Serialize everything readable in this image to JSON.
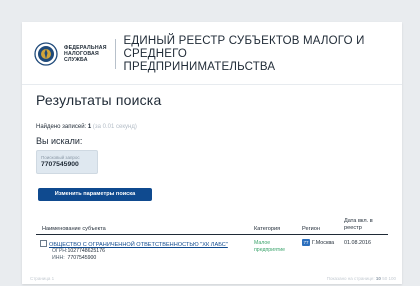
{
  "header": {
    "org_line1": "ФЕДЕРАЛЬНАЯ",
    "org_line2": "НАЛОГОВАЯ СЛУЖБА",
    "registry_title_line1": "ЕДИНЫЙ РЕЕСТР СУБЪЕКТОВ МАЛОГО И СРЕДНЕГО",
    "registry_title_line2": "ПРЕДПРИНИМАТЕЛЬСТВА"
  },
  "results": {
    "title": "Результаты поиска",
    "found_label": "Найдено записей:",
    "found_count": "1",
    "found_note": "(за 0.01 секунд)",
    "you_searched_label": "Вы искали:",
    "query_label": "Поисковый запрос",
    "query_value": "7707545900",
    "change_button": "Изменить параметры поиска"
  },
  "table": {
    "headers": {
      "subject": "Наименование субъекта",
      "category": "Категория",
      "region": "Регион",
      "date_line1": "Дата вкл. в",
      "date_line2": "реестр"
    },
    "rows": [
      {
        "subject_name": "ОБЩЕСТВО С ОГРАНИЧЕННОЙ ОТВЕТСТВЕННОСТЬЮ \"ХК ЛАБС\"",
        "ogrn_label": "ОГРН:",
        "ogrn": "1027748625176",
        "inn_label": "ИНН:",
        "inn": "7707545900",
        "category_line1": "Малое",
        "category_line2": "предприятие",
        "region_code": "77",
        "region_name": "Г.Москва",
        "date": "01.08.2016"
      }
    ]
  },
  "footer": {
    "left": "Страница 1",
    "right_prefix": "Показано на странице:",
    "right_sizes": [
      "10",
      "50",
      "100"
    ]
  },
  "colors": {
    "accent": "#0f4a8f",
    "category_green": "#3aa36b",
    "background": "#e9ecef"
  },
  "icons": {
    "logo": "fns-emblem-icon",
    "checkbox": "checkbox-icon"
  }
}
